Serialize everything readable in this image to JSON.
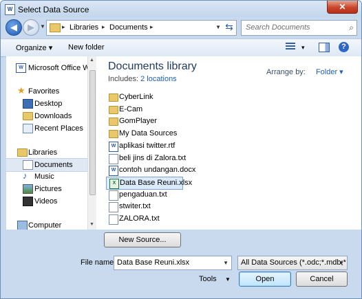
{
  "window": {
    "title": "Select Data Source",
    "close_label": "✕"
  },
  "address": {
    "crumbs": [
      "Libraries",
      "Documents"
    ]
  },
  "search": {
    "placeholder": "Search Documents"
  },
  "toolbar": {
    "organize": "Organize ▾",
    "new_folder": "New folder",
    "view_dd": "▾"
  },
  "nav": {
    "top_item": "Microsoft Office W",
    "favorites_header": "Favorites",
    "favorites": [
      "Desktop",
      "Downloads",
      "Recent Places"
    ],
    "libraries_header": "Libraries",
    "libraries": [
      "Documents",
      "Music",
      "Pictures",
      "Videos"
    ],
    "computer": "Computer"
  },
  "library": {
    "title": "Documents library",
    "includes_label": "Includes:",
    "locations_link": "2 locations",
    "arrange_label": "Arrange by:",
    "arrange_value": "Folder ▾"
  },
  "files": [
    {
      "name": "CyberLink",
      "type": "folder"
    },
    {
      "name": "E-Cam",
      "type": "folder"
    },
    {
      "name": "GomPlayer",
      "type": "folder"
    },
    {
      "name": "My Data Sources",
      "type": "ds"
    },
    {
      "name": "aplikasi twitter.rtf",
      "type": "word"
    },
    {
      "name": "beli jins di Zalora.txt",
      "type": "doc"
    },
    {
      "name": "contoh undangan.docx",
      "type": "word"
    },
    {
      "name": "Data Base Reuni.xlsx",
      "type": "excel",
      "selected": true
    },
    {
      "name": "pengaduan.txt",
      "type": "doc"
    },
    {
      "name": "stwiter.txt",
      "type": "doc"
    },
    {
      "name": "ZALORA.txt",
      "type": "doc"
    }
  ],
  "bottom": {
    "new_source": "New Source...",
    "file_name_label": "File name:",
    "file_name_value": "Data Base Reuni.xlsx",
    "filter_value": "All Data Sources (*.odc;*.mdb;*",
    "tools_label": "Tools",
    "open_label": "Open",
    "cancel_label": "Cancel"
  }
}
